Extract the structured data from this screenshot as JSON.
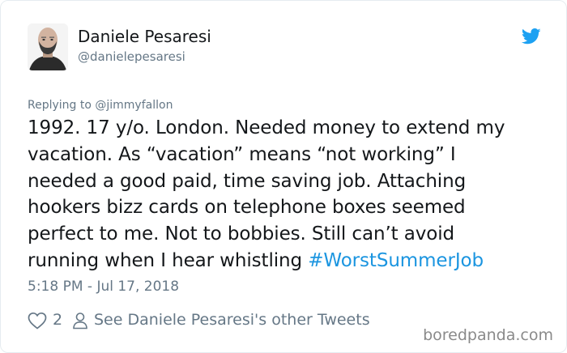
{
  "user": {
    "name": "Daniele Pesaresi",
    "handle": "@danielepesaresi"
  },
  "tweet": {
    "reply_to": "Replying to @jimmyfallon",
    "text": "1992. 17 y/o. London. Needed money to extend my\nvacation. As “vacation” means “not working” I\nneeded a good paid, time saving job. Attaching\nhookers bizz cards on telephone boxes seemed\nperfect to me. Not to bobbies. Still can’t avoid\nrunning when I hear whistling ",
    "hashtag": "#WorstSummerJob",
    "timestamp": "5:18 PM - Jul 17, 2018"
  },
  "footer": {
    "like_count": "2",
    "see_other_label": "See Daniele Pesaresi's other Tweets"
  },
  "watermark": "boredpanda.com",
  "icons": {
    "heart": "heart-icon",
    "person": "person-icon",
    "twitter": "twitter-bird-icon"
  },
  "colors": {
    "link": "#1b95e0",
    "secondary_text": "#657786",
    "primary_text": "#14171a",
    "twitter_blue": "#1da1f2"
  }
}
